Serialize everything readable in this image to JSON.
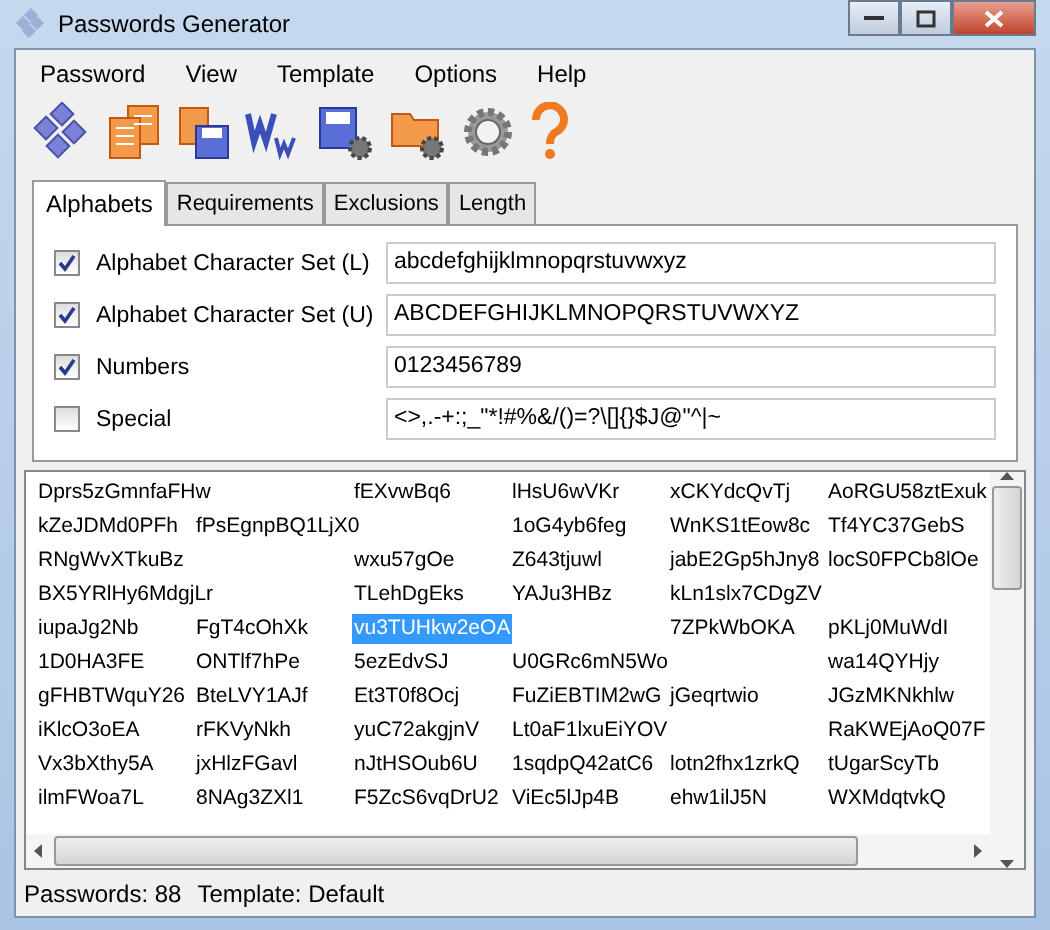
{
  "window": {
    "title": "Passwords Generator"
  },
  "menu": [
    "Password",
    "View",
    "Template",
    "Options",
    "Help"
  ],
  "tabs": [
    {
      "label": "Alphabets",
      "selected": true
    },
    {
      "label": "Requirements",
      "selected": false
    },
    {
      "label": "Exclusions",
      "selected": false
    },
    {
      "label": "Length",
      "selected": false
    }
  ],
  "alphabets": [
    {
      "label": "Alphabet Character Set (L)",
      "checked": true,
      "value": "abcdefghijklmnopqrstuvwxyz"
    },
    {
      "label": "Alphabet Character Set (U)",
      "checked": true,
      "value": "ABCDEFGHIJKLMNOPQRSTUVWXYZ"
    },
    {
      "label": "Numbers",
      "checked": true,
      "value": "0123456789"
    },
    {
      "label": "Special",
      "checked": false,
      "value": "<>,.-+:;_\"*!#%&/()=?\\[]{}$J@\"^|~"
    }
  ],
  "passwords": [
    [
      {
        "kind": "password",
        "text": "Dprs5zGmnfaFHw",
        "selected": false
      },
      {
        "kind": "gap"
      },
      {
        "kind": "password",
        "text": "fEXvwBq6",
        "selected": false
      },
      {
        "kind": "password",
        "text": "lHsU6wVKr",
        "selected": false
      },
      {
        "kind": "password",
        "text": "xCKYdcQvTj",
        "selected": false
      },
      {
        "kind": "password",
        "text": "AoRGU58ztExuk",
        "selected": false
      }
    ],
    [
      {
        "kind": "password",
        "text": "kZeJDMd0PFh",
        "selected": false
      },
      {
        "kind": "password",
        "text": "fPsEgnpBQ1LjX0",
        "selected": false
      },
      {
        "kind": "gap"
      },
      {
        "kind": "password",
        "text": "1oG4yb6feg",
        "selected": false
      },
      {
        "kind": "password",
        "text": "WnKS1tEow8c",
        "selected": false
      },
      {
        "kind": "password",
        "text": "Tf4YC37GebS",
        "selected": false
      }
    ],
    [
      {
        "kind": "password",
        "text": "RNgWvXTkuBz",
        "selected": false
      },
      {
        "kind": "gap"
      },
      {
        "kind": "password",
        "text": "wxu57gOe",
        "selected": false
      },
      {
        "kind": "password",
        "text": "Z643tjuwl",
        "selected": false
      },
      {
        "kind": "password",
        "text": "jabE2Gp5hJny8",
        "selected": false
      },
      {
        "kind": "password",
        "text": "locS0FPCb8lOe",
        "selected": false
      }
    ],
    [
      {
        "kind": "password",
        "text": "BX5YRlHy6MdgjLr",
        "selected": false
      },
      {
        "kind": "gap"
      },
      {
        "kind": "password",
        "text": "TLehDgEks",
        "selected": false
      },
      {
        "kind": "password",
        "text": "YAJu3HBz",
        "selected": false
      },
      {
        "kind": "password",
        "text": "kLn1slx7CDgZV",
        "selected": false
      },
      {
        "kind": "gap"
      }
    ],
    [
      {
        "kind": "password",
        "text": "iupaJg2Nb",
        "selected": false
      },
      {
        "kind": "password",
        "text": "FgT4cOhXk",
        "selected": false
      },
      {
        "kind": "password",
        "text": "vu3TUHkw2eOA",
        "selected": true
      },
      {
        "kind": "gap"
      },
      {
        "kind": "password",
        "text": "7ZPkWbOKA",
        "selected": false
      },
      {
        "kind": "password",
        "text": "pKLj0MuWdI",
        "selected": false
      }
    ],
    [
      {
        "kind": "password",
        "text": "1D0HA3FE",
        "selected": false
      },
      {
        "kind": "password",
        "text": "ONTlf7hPe",
        "selected": false
      },
      {
        "kind": "password",
        "text": "5ezEdvSJ",
        "selected": false
      },
      {
        "kind": "password",
        "text": "U0GRc6mN5Wo",
        "selected": false
      },
      {
        "kind": "gap"
      },
      {
        "kind": "password",
        "text": "wa14QYHjy",
        "selected": false
      }
    ],
    [
      {
        "kind": "password",
        "text": "gFHBTWquY26",
        "selected": false
      },
      {
        "kind": "password",
        "text": "BteLVY1AJf",
        "selected": false
      },
      {
        "kind": "password",
        "text": "Et3T0f8Ocj",
        "selected": false
      },
      {
        "kind": "password",
        "text": "FuZiEBTIM2wG",
        "selected": false
      },
      {
        "kind": "password",
        "text": "jGeqrtwio",
        "selected": false
      },
      {
        "kind": "password",
        "text": "JGzMKNkhlw",
        "selected": false
      }
    ],
    [
      {
        "kind": "password",
        "text": "iKlcO3oEA",
        "selected": false
      },
      {
        "kind": "password",
        "text": "rFKVyNkh",
        "selected": false
      },
      {
        "kind": "password",
        "text": "yuC72akgjnV",
        "selected": false
      },
      {
        "kind": "password",
        "text": "Lt0aF1lxuEiYOV",
        "selected": false
      },
      {
        "kind": "gap"
      },
      {
        "kind": "password",
        "text": "RaKWEjAoQ07F",
        "selected": false
      }
    ],
    [
      {
        "kind": "password",
        "text": "Vx3bXthy5A",
        "selected": false
      },
      {
        "kind": "password",
        "text": "jxHlzFGavl",
        "selected": false
      },
      {
        "kind": "password",
        "text": "nJtHSOub6U",
        "selected": false
      },
      {
        "kind": "password",
        "text": "1sqdpQ42atC6",
        "selected": false
      },
      {
        "kind": "password",
        "text": "lotn2fhx1zrkQ",
        "selected": false
      },
      {
        "kind": "password",
        "text": "tUgarScyTb",
        "selected": false
      }
    ],
    [
      {
        "kind": "password",
        "text": "ilmFWoa7L",
        "selected": false
      },
      {
        "kind": "password",
        "text": "8NAg3ZXl1",
        "selected": false
      },
      {
        "kind": "password",
        "text": "F5ZcS6vqDrU2",
        "selected": false
      },
      {
        "kind": "password",
        "text": "ViEc5lJp4B",
        "selected": false
      },
      {
        "kind": "password",
        "text": "ehw1ilJ5N",
        "selected": false
      },
      {
        "kind": "password",
        "text": "WXMdqtvkQ",
        "selected": false
      }
    ]
  ],
  "status_bar": [
    "Passwords: 88",
    "Template: Default"
  ]
}
